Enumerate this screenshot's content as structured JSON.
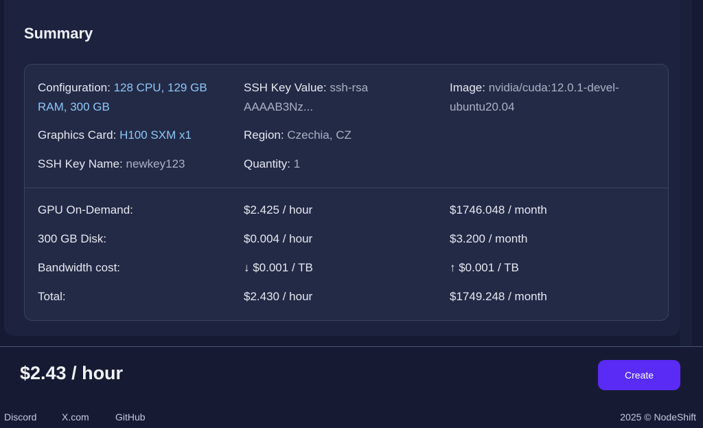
{
  "summary": {
    "title": "Summary",
    "config": {
      "configuration_label": "Configuration:",
      "configuration_value": "128 CPU, 129 GB RAM, 300 GB",
      "graphics_label": "Graphics Card:",
      "graphics_value": "H100 SXM x1",
      "ssh_name_label": "SSH Key Name:",
      "ssh_name_value": "newkey123",
      "ssh_value_label": "SSH Key Value:",
      "ssh_value_value": "ssh-rsa AAAAB3Nz...",
      "region_label": "Region:",
      "region_value": "Czechia, CZ",
      "quantity_label": "Quantity:",
      "quantity_value": "1",
      "image_label": "Image:",
      "image_value": "nvidia/cuda:12.0.1-devel-ubuntu20.04"
    },
    "costs": [
      {
        "label": "GPU On-Demand:",
        "hourly": "$2.425 / hour",
        "monthly": "$1746.048 / month"
      },
      {
        "label": "300 GB Disk:",
        "hourly": "$0.004 / hour",
        "monthly": "$3.200 / month"
      },
      {
        "label": "Bandwidth cost:",
        "hourly": "↓ $0.001 / TB",
        "monthly": "↑ $0.001 / TB"
      },
      {
        "label": "Total:",
        "hourly": "$2.430 / hour",
        "monthly": "$1749.248 / month"
      }
    ]
  },
  "footer_bar": {
    "price": "$2.43 / hour",
    "create_label": "Create"
  },
  "footer": {
    "links": [
      "Discord",
      "X.com",
      "GitHub"
    ],
    "copyright": "2025 © NodeShift"
  },
  "colors": {
    "accent": "#5a2bf5",
    "highlight_text": "#8ec7f6"
  }
}
